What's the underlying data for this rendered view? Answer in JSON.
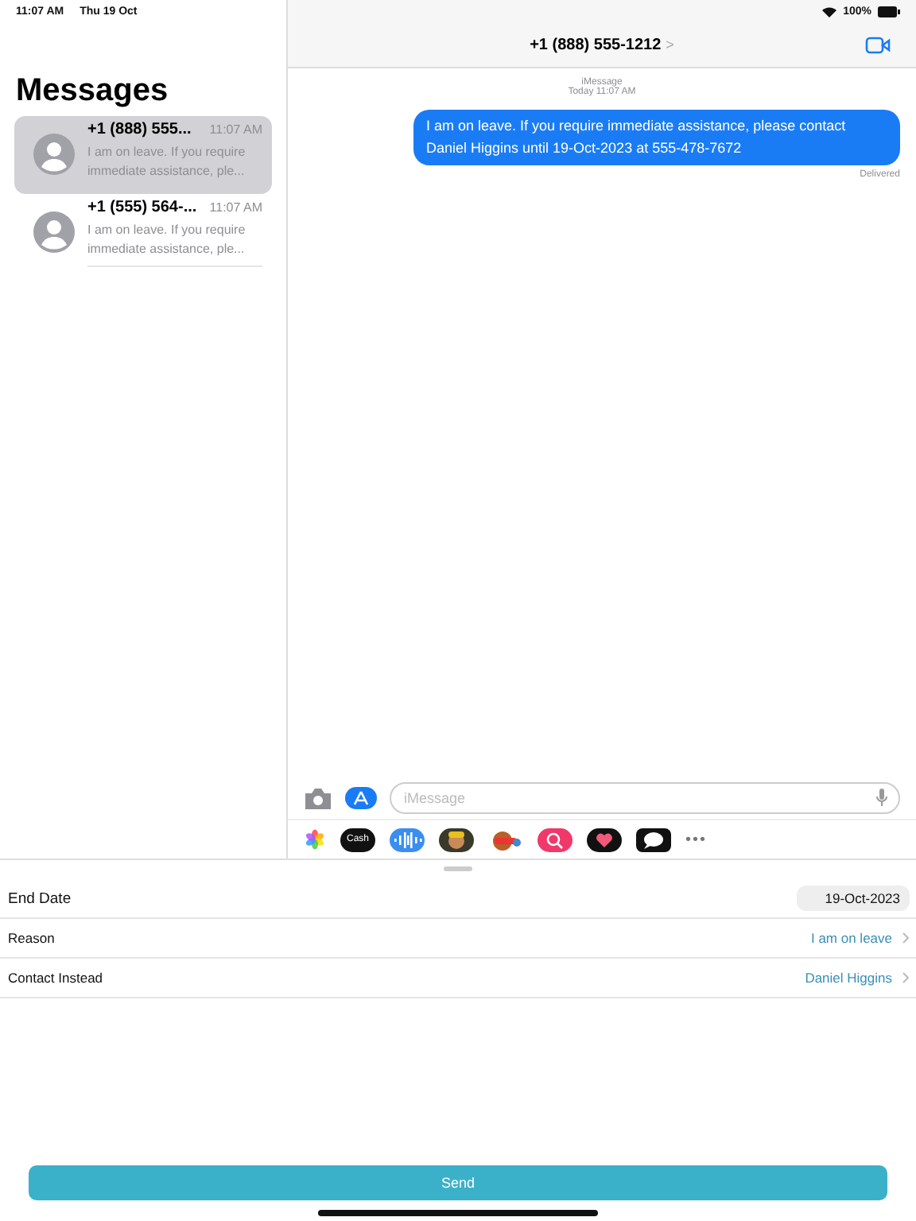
{
  "status_bar": {
    "time": "11:07 AM",
    "date": "Thu 19 Oct",
    "battery": "100%"
  },
  "sidebar": {
    "title": "Messages",
    "conversations": [
      {
        "name": "+1 (888) 555...",
        "time": "11:07 AM",
        "preview": "I am on leave. If you require immediate assistance, ple...",
        "selected": true
      },
      {
        "name": "+1 (555) 564-...",
        "time": "11:07 AM",
        "preview": "I am on leave. If you require immediate assistance, ple...",
        "selected": false
      }
    ]
  },
  "chat": {
    "title": "+1 (888) 555-1212",
    "chevron": ">",
    "service": "iMessage",
    "timestamp": "Today 11:07 AM",
    "messages": [
      {
        "text": "I am on leave. If you require immediate assistance, please contact Daniel Higgins until 19-Oct-2023 at 555-478-7672",
        "status": "Delivered"
      }
    ],
    "input": {
      "placeholder": "iMessage"
    },
    "apps": [
      {
        "kind": "photos"
      },
      {
        "kind": "cash",
        "label": "Cash"
      },
      {
        "kind": "audio"
      },
      {
        "kind": "memoji"
      },
      {
        "kind": "stickers"
      },
      {
        "kind": "search"
      },
      {
        "kind": "heart"
      },
      {
        "kind": "bubble"
      },
      {
        "kind": "more",
        "label": "•••"
      }
    ]
  },
  "form": {
    "rows": [
      {
        "kind": "date",
        "label": "End Date",
        "value": "19-Oct-2023"
      },
      {
        "kind": "link",
        "label": "Reason",
        "value": "I am on leave"
      },
      {
        "kind": "link",
        "label": "Contact Instead",
        "value": "Daniel Higgins"
      }
    ],
    "button": "Send"
  }
}
